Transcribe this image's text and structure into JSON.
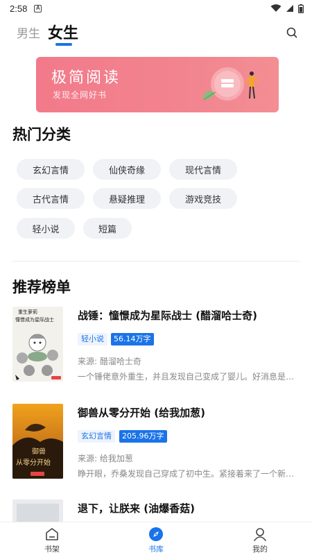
{
  "status_bar": {
    "time": "2:58",
    "notification_letter": "A"
  },
  "top_tabs": {
    "male": "男生",
    "female": "女生",
    "active": "female"
  },
  "banner": {
    "title": "极简阅读",
    "subtitle": "发现全网好书"
  },
  "categories": {
    "title": "热门分类",
    "items": [
      "玄幻言情",
      "仙侠奇缘",
      "现代言情",
      "古代言情",
      "悬疑推理",
      "游戏竞技",
      "轻小说",
      "短篇"
    ]
  },
  "ranking": {
    "title": "推荐榜单",
    "books": [
      {
        "title": "战锤：憧憬成为星际战士 (醋溜哈士奇)",
        "category": "轻小说",
        "word_count": "56.14万字",
        "source": "来源: 醋溜哈士奇",
        "description": "一个锤佬意外重生，并且发现自己变成了婴儿。好消息是这里是战锤宇宙",
        "cover_text": "重生萝莉 憧憬成为星际战士"
      },
      {
        "title": "御兽从零分开始 (给我加葱)",
        "category": "玄幻言情",
        "word_count": "205.96万字",
        "source": "来源: 给我加葱",
        "description": "睁开眼，乔桑发现自己穿成了初中生。紧接着来了一个新消息",
        "cover_text": "御兽 从零分开始"
      },
      {
        "title": "退下，让朕来 (油爆香菇)",
        "category": "",
        "word_count": "",
        "source": "",
        "description": "",
        "cover_text": ""
      }
    ]
  },
  "bottom_nav": {
    "items": [
      {
        "label": "书架",
        "icon": "bookshelf-icon"
      },
      {
        "label": "书库",
        "icon": "compass-icon"
      },
      {
        "label": "我的",
        "icon": "profile-icon"
      }
    ],
    "active": "书库"
  },
  "colors": {
    "accent": "#1a73e8",
    "banner": "#f2848f",
    "chip_bg": "#f0f2f5"
  }
}
